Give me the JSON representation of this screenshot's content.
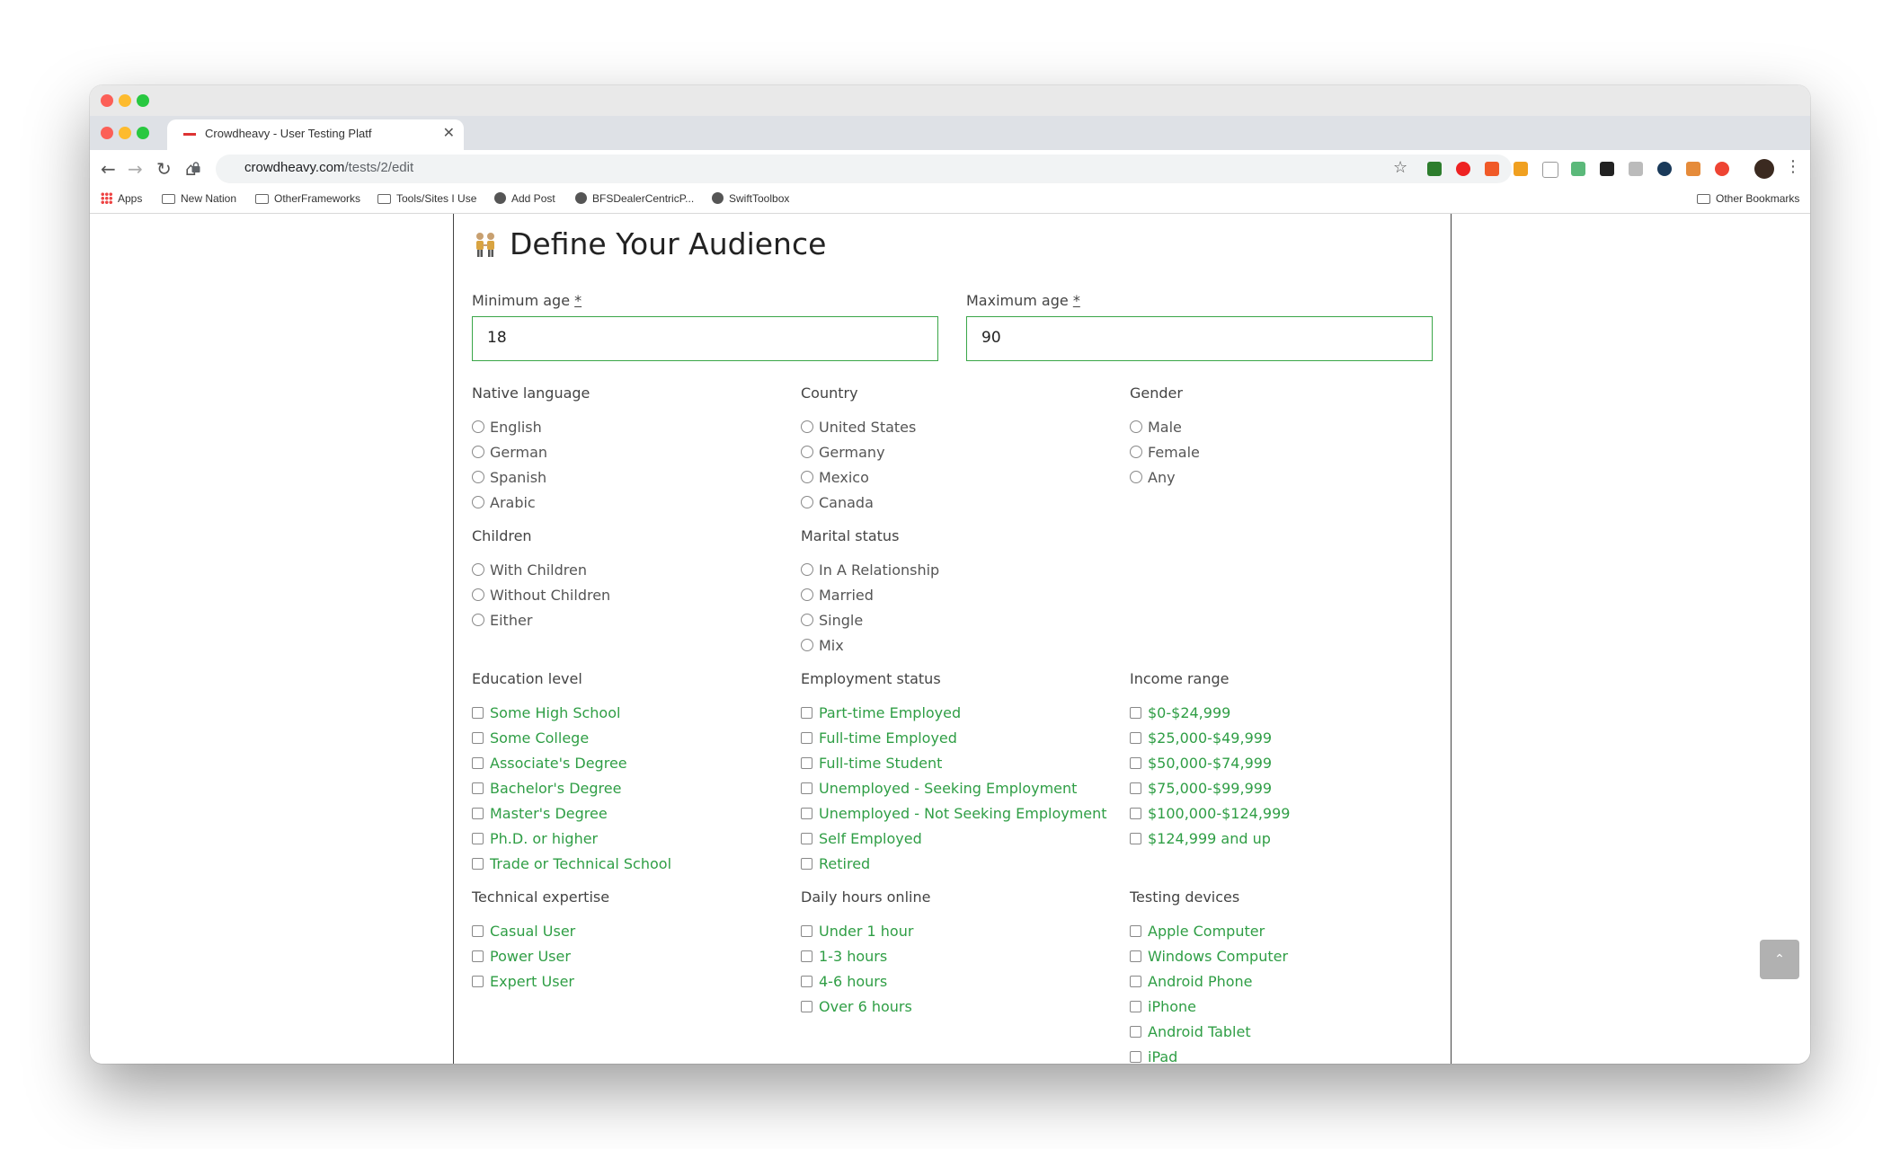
{
  "browser": {
    "tab_title": "Crowdheavy - User Testing Platf",
    "url_domain": "crowdheavy.com",
    "url_path": "/tests/2/edit",
    "new_tab": "+",
    "close_tab": "✕"
  },
  "bookmarks": {
    "apps": "Apps",
    "items": [
      "New Nation",
      "OtherFrameworks",
      "Tools/Sites I Use",
      "Add Post",
      "BFSDealerCentricP...",
      "SwiftToolbox"
    ],
    "other": "Other Bookmarks"
  },
  "page": {
    "title": "Define Your Audience",
    "min_age_label": "Minimum age",
    "max_age_label": "Maximum age",
    "required_mark": "*",
    "min_age_value": "18",
    "max_age_value": "90",
    "native_language": {
      "title": "Native language",
      "options": [
        "English",
        "German",
        "Spanish",
        "Arabic"
      ]
    },
    "country": {
      "title": "Country",
      "options": [
        "United States",
        "Germany",
        "Mexico",
        "Canada"
      ]
    },
    "gender": {
      "title": "Gender",
      "options": [
        "Male",
        "Female",
        "Any"
      ]
    },
    "children": {
      "title": "Children",
      "options": [
        "With Children",
        "Without Children",
        "Either"
      ]
    },
    "marital": {
      "title": "Marital status",
      "options": [
        "In A Relationship",
        "Married",
        "Single",
        "Mix"
      ]
    },
    "education": {
      "title": "Education level",
      "options": [
        "Some High School",
        "Some College",
        "Associate's Degree",
        "Bachelor's Degree",
        "Master's Degree",
        "Ph.D. or higher",
        "Trade or Technical School"
      ]
    },
    "employment": {
      "title": "Employment status",
      "options": [
        "Part-time Employed",
        "Full-time Employed",
        "Full-time Student",
        "Unemployed - Seeking Employment",
        "Unemployed - Not Seeking Employment",
        "Self Employed",
        "Retired"
      ]
    },
    "income": {
      "title": "Income range",
      "options": [
        "$0-$24,999",
        "$25,000-$49,999",
        "$50,000-$74,999",
        "$75,000-$99,999",
        "$100,000-$124,999",
        "$124,999 and up"
      ]
    },
    "expertise": {
      "title": "Technical expertise",
      "options": [
        "Casual User",
        "Power User",
        "Expert User"
      ]
    },
    "hours": {
      "title": "Daily hours online",
      "options": [
        "Under 1 hour",
        "1-3 hours",
        "4-6 hours",
        "Over 6 hours"
      ]
    },
    "devices": {
      "title": "Testing devices",
      "options": [
        "Apple Computer",
        "Windows Computer",
        "Android Phone",
        "iPhone",
        "Android Tablet",
        "iPad"
      ]
    }
  },
  "colors": {
    "accent": "#2f9e45",
    "input_border": "#3aa648"
  }
}
